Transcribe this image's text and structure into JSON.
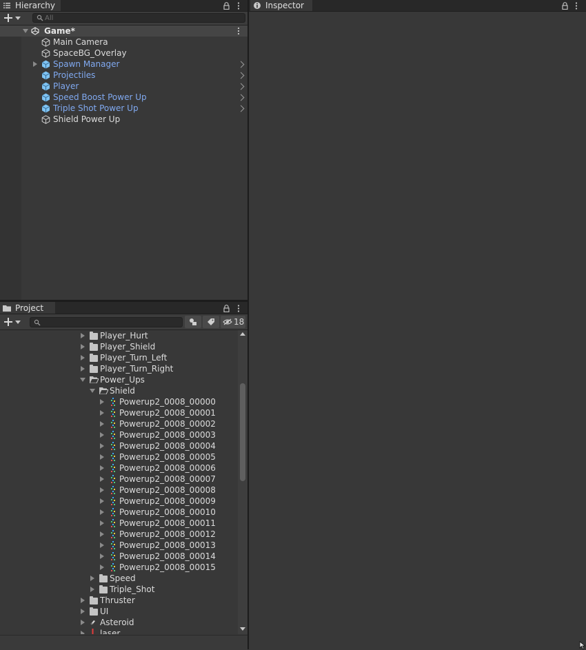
{
  "hierarchy": {
    "tab_label": "Hierarchy",
    "search_placeholder": "All",
    "scene": {
      "name": "Game*"
    },
    "items": [
      {
        "label": "Main Camera",
        "kind": "object",
        "expandable": false
      },
      {
        "label": "SpaceBG_Overlay",
        "kind": "object",
        "expandable": false
      },
      {
        "label": "Spawn Manager",
        "kind": "prefab",
        "expandable": true
      },
      {
        "label": "Projectiles",
        "kind": "prefab",
        "expandable": false
      },
      {
        "label": "Player",
        "kind": "prefab",
        "expandable": false
      },
      {
        "label": "Speed Boost Power Up",
        "kind": "prefab",
        "expandable": false
      },
      {
        "label": "Triple Shot Power Up",
        "kind": "prefab",
        "expandable": false
      },
      {
        "label": "Shield Power Up",
        "kind": "object",
        "expandable": false
      }
    ]
  },
  "inspector": {
    "tab_label": "Inspector"
  },
  "project": {
    "tab_label": "Project",
    "search_placeholder": "",
    "hidden_count": "18",
    "tree": [
      {
        "label": "Player_Hurt",
        "type": "folder",
        "state": "collapsed"
      },
      {
        "label": "Player_Shield",
        "type": "folder",
        "state": "collapsed"
      },
      {
        "label": "Player_Turn_Left",
        "type": "folder",
        "state": "collapsed"
      },
      {
        "label": "Player_Turn_Right",
        "type": "folder",
        "state": "collapsed"
      },
      {
        "label": "Power_Ups",
        "type": "folder",
        "state": "open"
      },
      {
        "label": "Shield",
        "type": "folder",
        "state": "open"
      },
      {
        "label": "Powerup2_0008_00000",
        "type": "sprite"
      },
      {
        "label": "Powerup2_0008_00001",
        "type": "sprite"
      },
      {
        "label": "Powerup2_0008_00002",
        "type": "sprite"
      },
      {
        "label": "Powerup2_0008_00003",
        "type": "sprite"
      },
      {
        "label": "Powerup2_0008_00004",
        "type": "sprite"
      },
      {
        "label": "Powerup2_0008_00005",
        "type": "sprite"
      },
      {
        "label": "Powerup2_0008_00006",
        "type": "sprite"
      },
      {
        "label": "Powerup2_0008_00007",
        "type": "sprite"
      },
      {
        "label": "Powerup2_0008_00008",
        "type": "sprite"
      },
      {
        "label": "Powerup2_0008_00009",
        "type": "sprite"
      },
      {
        "label": "Powerup2_0008_00010",
        "type": "sprite"
      },
      {
        "label": "Powerup2_0008_00011",
        "type": "sprite"
      },
      {
        "label": "Powerup2_0008_00012",
        "type": "sprite"
      },
      {
        "label": "Powerup2_0008_00013",
        "type": "sprite"
      },
      {
        "label": "Powerup2_0008_00014",
        "type": "sprite"
      },
      {
        "label": "Powerup2_0008_00015",
        "type": "sprite"
      },
      {
        "label": "Speed",
        "type": "folder",
        "state": "collapsed"
      },
      {
        "label": "Triple_Shot",
        "type": "folder",
        "state": "collapsed"
      },
      {
        "label": "Thruster",
        "type": "folder",
        "state": "collapsed"
      },
      {
        "label": "UI",
        "type": "folder",
        "state": "collapsed"
      },
      {
        "label": "Asteroid",
        "type": "asset",
        "state": "collapsed"
      },
      {
        "label": "laser",
        "type": "asset",
        "state": "collapsed"
      }
    ]
  },
  "colors": {
    "prefab_text": "#80a9f0",
    "panel_bg": "#383838",
    "tab_strip": "#282828",
    "prefab_icon": "#7ec3f3"
  },
  "icons": {
    "hierarchy_tab": "list-icon",
    "inspector_tab": "info-icon",
    "project_tab": "folder-icon",
    "lock": "lock-icon",
    "menu": "kebab-menu-icon",
    "add": "plus-icon",
    "search": "magnifier-icon",
    "scene": "unity-logo-icon",
    "gameobject": "cube-icon",
    "prefab": "blue-cube-icon",
    "filter_type": "shapes-icon",
    "filter_label": "tag-icon",
    "hidden_packages": "eye-slash-icon"
  }
}
